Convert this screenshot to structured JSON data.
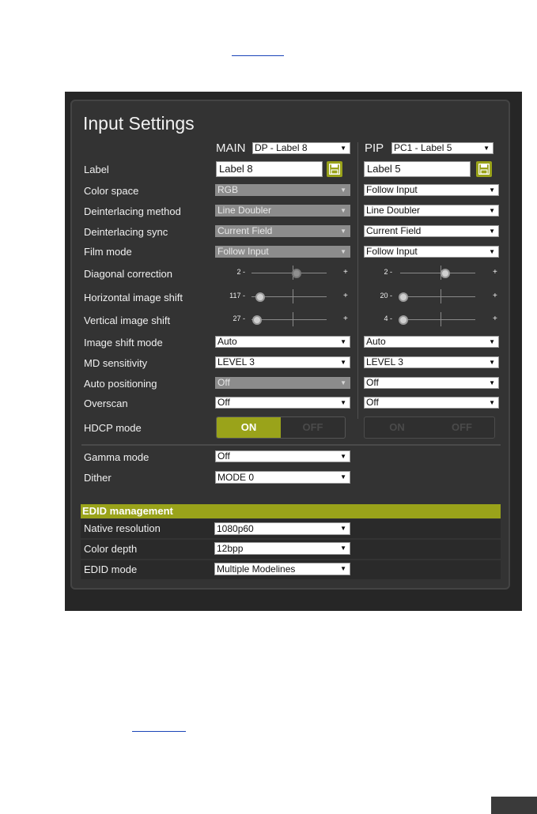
{
  "page": {
    "title": "Input Settings"
  },
  "columns": {
    "main": {
      "label": "MAIN",
      "source": "DP - Label 8"
    },
    "pip": {
      "label": "PIP",
      "source": "PC1 - Label 5"
    }
  },
  "rows": {
    "label": {
      "label": "Label",
      "main": "Label 8",
      "pip": "Label 5"
    },
    "color_space": {
      "label": "Color space",
      "main": "RGB",
      "pip": "Follow Input"
    },
    "deinterlacing_method": {
      "label": "Deinterlacing method",
      "main": "Line Doubler",
      "pip": "Line Doubler"
    },
    "deinterlacing_sync": {
      "label": "Deinterlacing sync",
      "main": "Current Field",
      "pip": "Current Field"
    },
    "film_mode": {
      "label": "Film mode",
      "main": "Follow Input",
      "pip": "Follow Input"
    },
    "diagonal_correction": {
      "label": "Diagonal correction",
      "main_value": "2 -",
      "pip_value": "2 -",
      "main_level": 0.6,
      "pip_level": 0.6
    },
    "horizontal_shift": {
      "label": "Horizontal image shift",
      "main_value": "117 -",
      "pip_value": "20 -",
      "main_level": 0.12,
      "pip_level": 0.04
    },
    "vertical_shift": {
      "label": "Vertical image shift",
      "main_value": "27 -",
      "pip_value": "4 -",
      "main_level": 0.07,
      "pip_level": 0.04
    },
    "image_shift_mode": {
      "label": "Image shift mode",
      "main": "Auto",
      "pip": "Auto"
    },
    "md_sensitivity": {
      "label": "MD sensitivity",
      "main": "LEVEL 3",
      "pip": "LEVEL 3"
    },
    "auto_positioning": {
      "label": "Auto positioning",
      "main": "Off",
      "pip": "Off"
    },
    "overscan": {
      "label": "Overscan",
      "main": "Off",
      "pip": "Off"
    },
    "hdcp_mode": {
      "label": "HDCP mode",
      "on": "ON",
      "off": "OFF"
    },
    "gamma_mode": {
      "label": "Gamma mode",
      "main": "Off"
    },
    "dither": {
      "label": "Dither",
      "main": "MODE 0"
    }
  },
  "slider_plus": "+",
  "edid": {
    "title": "EDID management",
    "native_resolution": {
      "label": "Native resolution",
      "value": "1080p60"
    },
    "color_depth": {
      "label": "Color depth",
      "value": "12bpp"
    },
    "edid_mode": {
      "label": "EDID mode",
      "value": "Multiple Modelines"
    }
  },
  "icons": {
    "save": "floppy-disk-icon",
    "dropdown": "chevron-down-icon"
  },
  "colors": {
    "accent": "#9aa31a",
    "panel": "#333333",
    "background": "#262626"
  }
}
